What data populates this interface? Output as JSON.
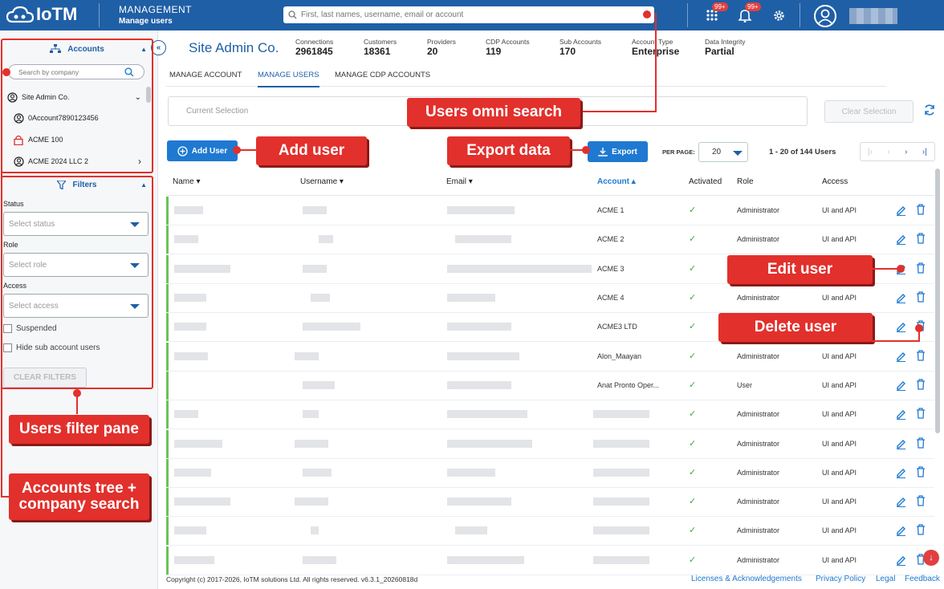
{
  "app": {
    "logo_text": "IoTM",
    "section_title": "MANAGEMENT",
    "section_subtitle": "Manage users",
    "search_placeholder": "First, last names, username, email or account",
    "apps_badge": "99+",
    "notif_badge": "99+"
  },
  "sidebar": {
    "accounts_header": "Accounts",
    "company_search_placeholder": "Search by company",
    "tree": [
      {
        "label": "Site Admin Co.",
        "icon": "user-circle-icon",
        "expand": "chevron-down"
      },
      {
        "label": "0Account7890123456",
        "icon": "user-circle-icon",
        "expand": ""
      },
      {
        "label": "ACME 100",
        "icon": "lock-icon",
        "expand": ""
      },
      {
        "label": "ACME 2024 LLC 2",
        "icon": "user-circle-icon",
        "expand": "chevron-right"
      }
    ],
    "filters_header": "Filters",
    "status_label": "Status",
    "status_placeholder": "Select status",
    "role_label": "Role",
    "role_placeholder": "Select role",
    "access_label": "Access",
    "access_placeholder": "Select access",
    "suspended_label": "Suspended",
    "hide_sub_label": "Hide sub account users",
    "clear_filters": "CLEAR FILTERS"
  },
  "header": {
    "title": "Site Admin Co.",
    "stats": [
      {
        "label": "Connections",
        "value": "2961845"
      },
      {
        "label": "Customers",
        "value": "18361"
      },
      {
        "label": "Providers",
        "value": "20"
      },
      {
        "label": "CDP Accounts",
        "value": "119"
      },
      {
        "label": "Sub Accounts",
        "value": "170"
      },
      {
        "label": "Account Type",
        "value": "Enterprise"
      },
      {
        "label": "Data Integrity",
        "value": "Partial"
      }
    ]
  },
  "tabs": [
    "MANAGE ACCOUNT",
    "MANAGE USERS",
    "MANAGE CDP ACCOUNTS"
  ],
  "selection": {
    "placeholder": "Current Selection",
    "clear": "Clear Selection"
  },
  "toolbar": {
    "add_user": "Add User",
    "export": "Export",
    "per_page_label": "PER PAGE:",
    "per_page": "20",
    "range": "1 - 20 of 144 Users"
  },
  "table": {
    "columns": [
      "Name",
      "Username",
      "Email",
      "Account",
      "Activated",
      "Role",
      "Access"
    ],
    "rows": [
      {
        "account": "ACME 1",
        "role": "Administrator",
        "access": "UI and API"
      },
      {
        "account": "ACME 2",
        "role": "Administrator",
        "access": "UI and API"
      },
      {
        "account": "ACME 3",
        "role": "",
        "access": ""
      },
      {
        "account": "ACME 4",
        "role": "Administrator",
        "access": "UI and API"
      },
      {
        "account": "ACME3 LTD",
        "role": "",
        "access": ""
      },
      {
        "account": "Alon_Maayan",
        "role": "Administrator",
        "access": "UI and API"
      },
      {
        "account": "Anat Pronto Oper...",
        "role": "User",
        "access": "UI and API"
      },
      {
        "account": "",
        "role": "Administrator",
        "access": "UI and API"
      },
      {
        "account": "",
        "role": "Administrator",
        "access": "UI and API"
      },
      {
        "account": "",
        "role": "Administrator",
        "access": "UI and API"
      },
      {
        "account": "",
        "role": "Administrator",
        "access": "UI and API"
      },
      {
        "account": "",
        "role": "Administrator",
        "access": "UI and API"
      },
      {
        "account": "",
        "role": "Administrator",
        "access": "UI and API"
      }
    ]
  },
  "footer": {
    "copyright": "Copyright (c) 2017-2026, IoTM solutions Ltd. All rights reserved. v6.3.1_20260818d",
    "links": [
      "Licenses & Acknowledgements",
      "Privacy Policy",
      "Legal",
      "Feedback"
    ]
  },
  "callouts": {
    "omni": "Users omni search",
    "add": "Add user",
    "export": "Export data",
    "edit": "Edit user",
    "delete": "Delete user",
    "filter": "Users filter pane",
    "tree": "Accounts tree + company search"
  },
  "colors": {
    "brand": "#1f5fa6",
    "accent": "#1f79d1",
    "callout": "#e2302c",
    "active_bar": "#6cc15a"
  }
}
